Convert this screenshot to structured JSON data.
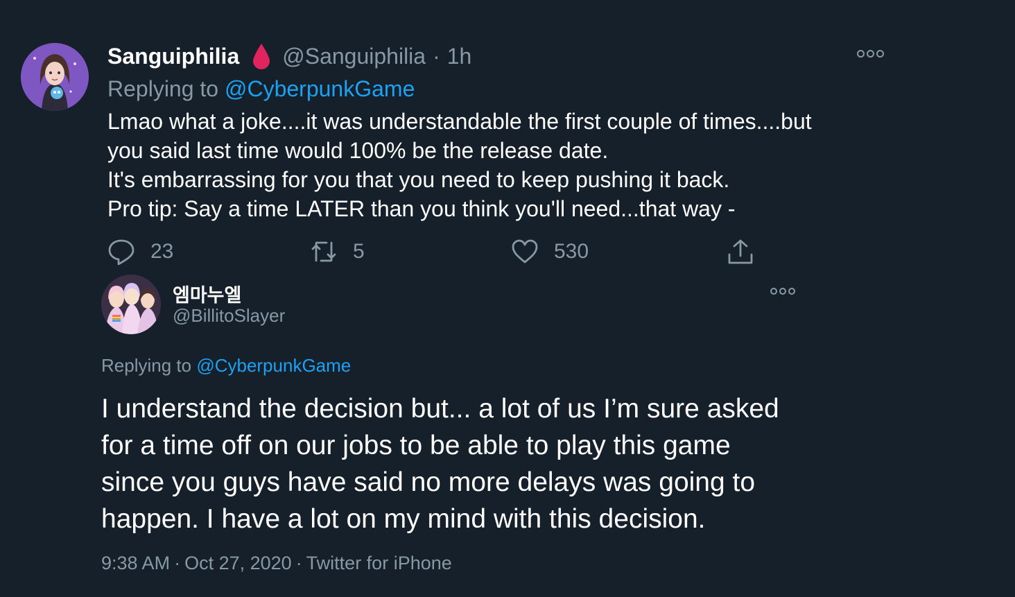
{
  "tweet1": {
    "display_name": "Sanguiphilia",
    "name_emoji": "drop-of-blood",
    "handle": "@Sanguiphilia",
    "separator": "·",
    "time": "1h",
    "replying_prefix": "Replying to",
    "replying_to": "@CyberpunkGame",
    "body_lines": [
      "Lmao what a joke....it was understandable the first couple of times....but",
      "you said last time would 100% be the release date.",
      "It's embarrassing for you that you need to keep pushing it back.",
      "Pro tip: Say a time LATER than you think you'll need...that way -"
    ],
    "replies": "23",
    "retweets": "5",
    "likes": "530"
  },
  "tweet2": {
    "display_name": "엠마누엘",
    "handle": "@BillitoSlayer",
    "replying_prefix": "Replying to",
    "replying_to": "@CyberpunkGame",
    "body_lines": [
      "I understand the decision but... a lot of us I’m sure asked",
      "for a time off on our jobs to be able to play this game",
      "since you guys have said no more delays was going to",
      "happen. I have a lot on my mind with this decision."
    ],
    "time": "9:38 AM",
    "date": "Oct 27, 2020",
    "source": "Twitter for iPhone",
    "separator": "·"
  },
  "colors": {
    "background": "#15202b",
    "text_primary": "#ffffff",
    "text_secondary": "#8899a6",
    "link": "#1da1f2",
    "blood_drop": "#e0245e"
  },
  "icons": {
    "reply": "reply-icon",
    "retweet": "retweet-icon",
    "like": "like-icon",
    "share": "share-icon",
    "more": "more-icon"
  }
}
